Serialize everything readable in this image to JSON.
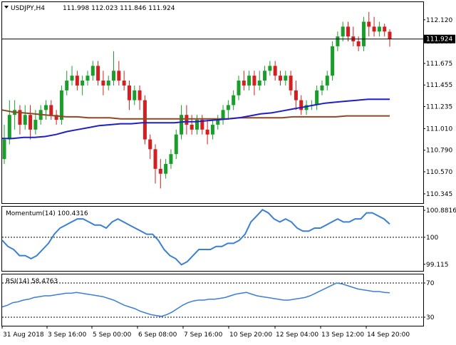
{
  "header": {
    "symbol": "USDJPY,H4",
    "ohlc": "111.998 112.023 111.846 111.924"
  },
  "chart_data": [
    {
      "type": "candlestick",
      "title": "USDJPY,H4",
      "ylim": [
        110.25,
        112.3
      ],
      "y_ticks": [
        "112.120",
        "111.900",
        "111.675",
        "111.455",
        "111.235",
        "111.010",
        "110.790",
        "110.570",
        "110.345"
      ],
      "current_price": "111.924",
      "up_color": "#1a9e2a",
      "down_color": "#d21f1f",
      "ma_fast_color": "#1f1fc8",
      "ma_slow_color": "#8b4a25",
      "candles": [
        [
          110.7,
          111.05,
          110.65,
          110.9
        ],
        [
          110.9,
          111.3,
          110.85,
          111.15
        ],
        [
          111.15,
          111.3,
          111.0,
          111.2
        ],
        [
          111.2,
          111.25,
          110.95,
          111.05
        ],
        [
          111.05,
          111.25,
          111.0,
          111.15
        ],
        [
          111.15,
          111.25,
          110.9,
          111.0
        ],
        [
          111.0,
          111.2,
          110.95,
          111.1
        ],
        [
          111.1,
          111.25,
          111.05,
          111.2
        ],
        [
          111.2,
          111.3,
          111.1,
          111.25
        ],
        [
          111.25,
          111.3,
          111.1,
          111.15
        ],
        [
          111.15,
          111.2,
          111.05,
          111.1
        ],
        [
          111.1,
          111.45,
          111.05,
          111.4
        ],
        [
          111.4,
          111.6,
          111.35,
          111.5
        ],
        [
          111.5,
          111.65,
          111.45,
          111.55
        ],
        [
          111.55,
          111.6,
          111.4,
          111.45
        ],
        [
          111.45,
          111.55,
          111.35,
          111.5
        ],
        [
          111.5,
          111.6,
          111.45,
          111.55
        ],
        [
          111.55,
          111.7,
          111.5,
          111.65
        ],
        [
          111.65,
          111.7,
          111.45,
          111.5
        ],
        [
          111.5,
          111.6,
          111.35,
          111.45
        ],
        [
          111.45,
          111.55,
          111.4,
          111.5
        ],
        [
          111.5,
          111.8,
          111.45,
          111.6
        ],
        [
          111.6,
          111.7,
          111.45,
          111.5
        ],
        [
          111.5,
          111.6,
          111.4,
          111.45
        ],
        [
          111.45,
          111.5,
          111.2,
          111.3
        ],
        [
          111.3,
          111.45,
          111.25,
          111.4
        ],
        [
          111.4,
          111.45,
          111.2,
          111.3
        ],
        [
          111.3,
          111.35,
          110.85,
          110.9
        ],
        [
          110.9,
          110.95,
          110.7,
          110.8
        ],
        [
          110.8,
          110.85,
          110.45,
          110.6
        ],
        [
          110.6,
          110.7,
          110.4,
          110.55
        ],
        [
          110.55,
          110.7,
          110.5,
          110.65
        ],
        [
          110.65,
          110.8,
          110.6,
          110.75
        ],
        [
          110.75,
          111.0,
          110.7,
          110.95
        ],
        [
          110.95,
          111.25,
          110.9,
          111.15
        ],
        [
          111.15,
          111.25,
          110.95,
          111.05
        ],
        [
          111.05,
          111.15,
          110.95,
          111.0
        ],
        [
          111.0,
          111.15,
          110.95,
          111.1
        ],
        [
          111.1,
          111.15,
          110.95,
          111.0
        ],
        [
          111.0,
          111.1,
          110.85,
          110.95
        ],
        [
          110.95,
          111.1,
          110.9,
          111.05
        ],
        [
          111.05,
          111.15,
          111.0,
          111.1
        ],
        [
          111.1,
          111.25,
          111.05,
          111.2
        ],
        [
          111.2,
          111.3,
          111.1,
          111.25
        ],
        [
          111.25,
          111.4,
          111.2,
          111.35
        ],
        [
          111.35,
          111.55,
          111.3,
          111.5
        ],
        [
          111.5,
          111.6,
          111.4,
          111.45
        ],
        [
          111.45,
          111.6,
          111.4,
          111.55
        ],
        [
          111.55,
          111.6,
          111.35,
          111.45
        ],
        [
          111.45,
          111.6,
          111.4,
          111.5
        ],
        [
          111.5,
          111.65,
          111.45,
          111.6
        ],
        [
          111.6,
          111.7,
          111.55,
          111.65
        ],
        [
          111.65,
          111.7,
          111.5,
          111.55
        ],
        [
          111.55,
          111.6,
          111.45,
          111.5
        ],
        [
          111.5,
          111.6,
          111.45,
          111.55
        ],
        [
          111.55,
          111.6,
          111.35,
          111.4
        ],
        [
          111.4,
          111.5,
          111.2,
          111.3
        ],
        [
          111.3,
          111.35,
          111.15,
          111.2
        ],
        [
          111.2,
          111.3,
          111.15,
          111.25
        ],
        [
          111.25,
          111.3,
          111.2,
          111.25
        ],
        [
          111.25,
          111.45,
          111.2,
          111.4
        ],
        [
          111.4,
          111.5,
          111.35,
          111.45
        ],
        [
          111.45,
          111.6,
          111.4,
          111.55
        ],
        [
          111.55,
          111.9,
          111.5,
          111.85
        ],
        [
          111.85,
          112.0,
          111.8,
          111.95
        ],
        [
          111.95,
          112.1,
          111.9,
          112.05
        ],
        [
          112.05,
          112.1,
          111.9,
          111.95
        ],
        [
          111.95,
          112.05,
          111.85,
          111.9
        ],
        [
          111.9,
          111.95,
          111.8,
          111.85
        ],
        [
          111.85,
          112.15,
          111.8,
          112.1
        ],
        [
          112.1,
          112.2,
          111.95,
          112.05
        ],
        [
          112.05,
          112.15,
          111.95,
          112.0
        ],
        [
          112.0,
          112.1,
          111.95,
          112.05
        ],
        [
          112.05,
          112.08,
          111.95,
          112.0
        ],
        [
          111.998,
          112.023,
          111.846,
          111.924
        ]
      ],
      "ma_fast": [
        110.91,
        110.91,
        110.92,
        110.92,
        110.93,
        110.95,
        110.98,
        111.0,
        111.02,
        111.04,
        111.05,
        111.06,
        111.06,
        111.07,
        111.07,
        111.07,
        111.07,
        111.08,
        111.08,
        111.09,
        111.1,
        111.11,
        111.12,
        111.14,
        111.16,
        111.17,
        111.19,
        111.21,
        111.23,
        111.25,
        111.27,
        111.28,
        111.29,
        111.3,
        111.31,
        111.31,
        111.31
      ],
      "ma_slow": [
        111.2,
        111.18,
        111.17,
        111.16,
        111.15,
        111.14,
        111.13,
        111.13,
        111.12,
        111.12,
        111.12,
        111.11,
        111.11,
        111.11,
        111.11,
        111.11,
        111.11,
        111.11,
        111.11,
        111.11,
        111.11,
        111.11,
        111.12,
        111.12,
        111.12,
        111.12,
        111.12,
        111.13,
        111.13,
        111.13,
        111.13,
        111.13,
        111.14,
        111.14,
        111.14,
        111.14,
        111.14
      ]
    },
    {
      "type": "line",
      "title": "Momentum(14) 100.4316",
      "ylim": [
        98.9,
        101.0
      ],
      "y_ticks": [
        "100.8816",
        "100",
        "99.115"
      ],
      "color": "#3a7fd5",
      "values": [
        99.9,
        99.7,
        99.6,
        99.4,
        99.4,
        99.3,
        99.4,
        99.6,
        99.8,
        100.1,
        100.3,
        100.4,
        100.5,
        100.6,
        100.6,
        100.5,
        100.4,
        100.4,
        100.3,
        100.5,
        100.6,
        100.5,
        100.4,
        100.3,
        100.2,
        100.1,
        100.1,
        99.9,
        99.6,
        99.4,
        99.3,
        99.1,
        99.2,
        99.4,
        99.6,
        99.6,
        99.6,
        99.7,
        99.7,
        99.8,
        99.8,
        99.9,
        100.1,
        100.5,
        100.7,
        100.9,
        100.8,
        100.6,
        100.5,
        100.6,
        100.5,
        100.3,
        100.2,
        100.2,
        100.3,
        100.3,
        100.4,
        100.5,
        100.6,
        100.5,
        100.5,
        100.6,
        100.6,
        100.8,
        100.8,
        100.7,
        100.6,
        100.43
      ]
    },
    {
      "type": "line",
      "title": "RSI(14) 58.4763",
      "ylim": [
        20,
        80
      ],
      "y_ticks": [
        "70",
        "30"
      ],
      "color": "#3a7fd5",
      "values": [
        42,
        44,
        47,
        48,
        50,
        51,
        53,
        54,
        55,
        55,
        56,
        57,
        58,
        58,
        59,
        58,
        57,
        56,
        55,
        54,
        52,
        50,
        47,
        44,
        42,
        40,
        37,
        35,
        33,
        32,
        31,
        33,
        36,
        40,
        44,
        47,
        49,
        50,
        50,
        51,
        51,
        52,
        53,
        55,
        57,
        58,
        59,
        57,
        55,
        54,
        53,
        52,
        51,
        50,
        50,
        51,
        52,
        53,
        55,
        58,
        61,
        64,
        67,
        70,
        69,
        67,
        65,
        63,
        62,
        61,
        60,
        60,
        59,
        58.48
      ]
    },
    {
      "type": "axis",
      "x_ticks": [
        "31 Aug 2018",
        "3 Sep 16:00",
        "5 Sep 00:00",
        "6 Sep 08:00",
        "7 Sep 16:00",
        "10 Sep 20:00",
        "12 Sep 04:00",
        "13 Sep 12:00",
        "14 Sep 20:00"
      ]
    }
  ]
}
